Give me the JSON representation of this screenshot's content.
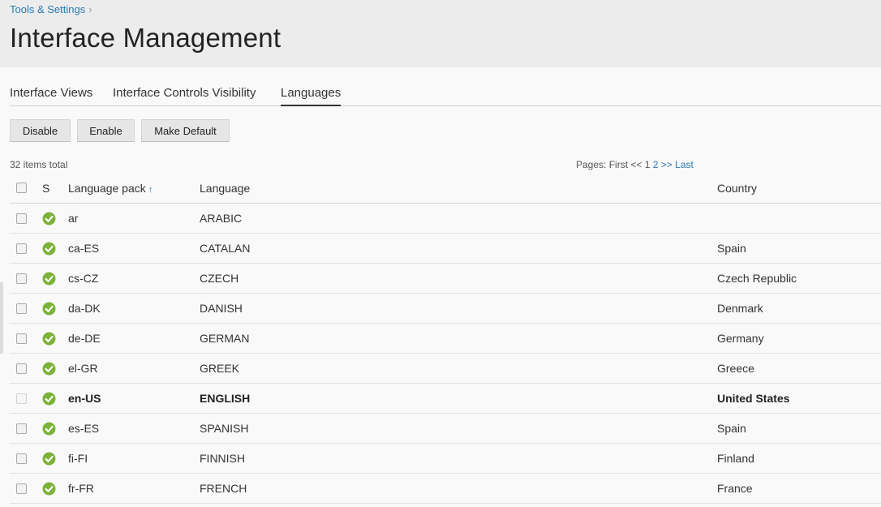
{
  "breadcrumb": {
    "label": "Tools & Settings"
  },
  "page": {
    "title": "Interface Management"
  },
  "tabs": [
    {
      "label": "Interface Views"
    },
    {
      "label": "Interface Controls Visibility"
    },
    {
      "label": "Languages"
    }
  ],
  "actions": {
    "disable": "Disable",
    "enable": "Enable",
    "make_default": "Make Default"
  },
  "list": {
    "total": "32 items total",
    "pager": {
      "prefix": "Pages:",
      "first": "First",
      "prev": "<<",
      "current": "1",
      "page2": "2",
      "next": ">>",
      "last": "Last"
    },
    "columns": {
      "status": "S",
      "pack": "Language pack",
      "language": "Language",
      "country": "Country"
    },
    "sort_icon": "arrow-up-icon",
    "status_color": "#7bb23a",
    "rows": [
      {
        "pack": "ar",
        "language": "ARABIC",
        "country": ""
      },
      {
        "pack": "ca-ES",
        "language": "CATALAN",
        "country": "Spain"
      },
      {
        "pack": "cs-CZ",
        "language": "CZECH",
        "country": "Czech Republic"
      },
      {
        "pack": "da-DK",
        "language": "DANISH",
        "country": "Denmark"
      },
      {
        "pack": "de-DE",
        "language": "GERMAN",
        "country": "Germany"
      },
      {
        "pack": "el-GR",
        "language": "GREEK",
        "country": "Greece"
      },
      {
        "pack": "en-US",
        "language": "ENGLISH",
        "country": "United States",
        "default": true
      },
      {
        "pack": "es-ES",
        "language": "SPANISH",
        "country": "Spain"
      },
      {
        "pack": "fi-FI",
        "language": "FINNISH",
        "country": "Finland"
      },
      {
        "pack": "fr-FR",
        "language": "FRENCH",
        "country": "France"
      }
    ]
  }
}
